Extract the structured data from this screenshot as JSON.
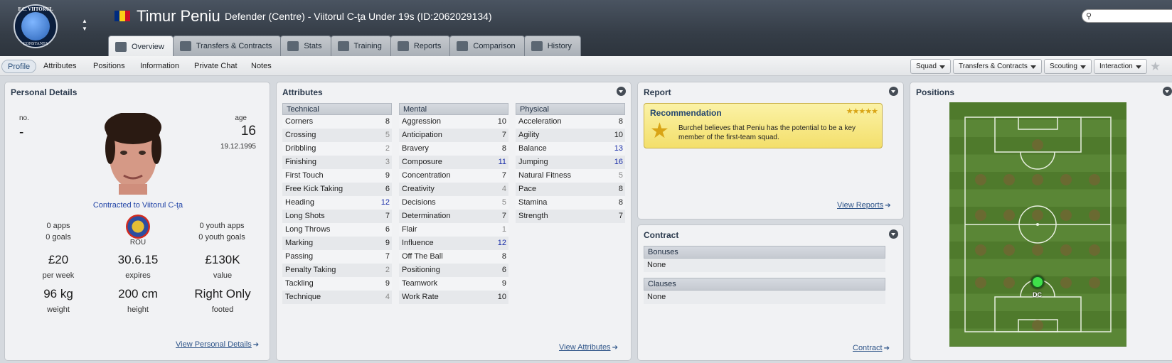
{
  "header": {
    "club_crest": {
      "top_text": "F.C. VIITORUL",
      "bottom_text": "CONSTANTA",
      "year": "2009"
    },
    "flag_colors": [
      "#002b7f",
      "#fcd116",
      "#ce1126"
    ],
    "player_name": "Timur Peniu",
    "player_subtitle": "Defender (Centre) - Viitorul C-ţa Under 19s (ID:2062029134)",
    "search_placeholder": ""
  },
  "tabs": [
    {
      "label": "Overview",
      "icon": "overview-icon",
      "active": true
    },
    {
      "label": "Transfers & Contracts",
      "icon": "document-icon"
    },
    {
      "label": "Stats",
      "icon": "stats-icon"
    },
    {
      "label": "Training",
      "icon": "training-icon"
    },
    {
      "label": "Reports",
      "icon": "report-icon"
    },
    {
      "label": "Comparison",
      "icon": "comparison-icon"
    },
    {
      "label": "History",
      "icon": "history-icon"
    }
  ],
  "subnav": {
    "links": [
      "Profile",
      "Attributes",
      "Positions",
      "Information",
      "Private Chat",
      "Notes"
    ],
    "active": "Profile",
    "dropdowns": [
      "Squad",
      "Transfers & Contracts",
      "Scouting",
      "Interaction"
    ]
  },
  "personal": {
    "title": "Personal Details",
    "no_label": "no.",
    "no_value": "-",
    "age_label": "age",
    "age_value": "16",
    "dob": "19.12.1995",
    "contracted": "Contracted to Viitorul C-ţa",
    "apps": "0 apps",
    "goals": "0 goals",
    "nation": "ROU",
    "youth_apps": "0 youth apps",
    "youth_goals": "0 youth goals",
    "wage": "£20",
    "wage_label": "per week",
    "expires": "30.6.15",
    "expires_label": "expires",
    "value": "£130K",
    "value_label": "value",
    "weight": "96 kg",
    "weight_label": "weight",
    "height": "200 cm",
    "height_label": "height",
    "footed": "Right Only",
    "footed_label": "footed",
    "link": "View Personal Details"
  },
  "attributes": {
    "title": "Attributes",
    "link": "View Attributes",
    "technical": {
      "header": "Technical",
      "rows": [
        {
          "name": "Corners",
          "value": 8
        },
        {
          "name": "Crossing",
          "value": 5
        },
        {
          "name": "Dribbling",
          "value": 2
        },
        {
          "name": "Finishing",
          "value": 3
        },
        {
          "name": "First Touch",
          "value": 9
        },
        {
          "name": "Free Kick Taking",
          "value": 6
        },
        {
          "name": "Heading",
          "value": 12
        },
        {
          "name": "Long Shots",
          "value": 7
        },
        {
          "name": "Long Throws",
          "value": 6
        },
        {
          "name": "Marking",
          "value": 9
        },
        {
          "name": "Passing",
          "value": 7
        },
        {
          "name": "Penalty Taking",
          "value": 2
        },
        {
          "name": "Tackling",
          "value": 9
        },
        {
          "name": "Technique",
          "value": 4
        }
      ]
    },
    "mental": {
      "header": "Mental",
      "rows": [
        {
          "name": "Aggression",
          "value": 10
        },
        {
          "name": "Anticipation",
          "value": 7
        },
        {
          "name": "Bravery",
          "value": 8
        },
        {
          "name": "Composure",
          "value": 11
        },
        {
          "name": "Concentration",
          "value": 7
        },
        {
          "name": "Creativity",
          "value": 4
        },
        {
          "name": "Decisions",
          "value": 5
        },
        {
          "name": "Determination",
          "value": 7
        },
        {
          "name": "Flair",
          "value": 1
        },
        {
          "name": "Influence",
          "value": 12
        },
        {
          "name": "Off The Ball",
          "value": 8
        },
        {
          "name": "Positioning",
          "value": 6
        },
        {
          "name": "Teamwork",
          "value": 9
        },
        {
          "name": "Work Rate",
          "value": 10
        }
      ]
    },
    "physical": {
      "header": "Physical",
      "rows": [
        {
          "name": "Acceleration",
          "value": 8
        },
        {
          "name": "Agility",
          "value": 10
        },
        {
          "name": "Balance",
          "value": 13
        },
        {
          "name": "Jumping",
          "value": 16
        },
        {
          "name": "Natural Fitness",
          "value": 5
        },
        {
          "name": "Pace",
          "value": 8
        },
        {
          "name": "Stamina",
          "value": 8
        },
        {
          "name": "Strength",
          "value": 7
        }
      ]
    }
  },
  "report": {
    "title": "Report",
    "rec_title": "Recommendation",
    "rec_stars": 5,
    "rec_text": "Burchel believes that Peniu has the potential to be a key member of the first-team squad.",
    "link": "View Reports"
  },
  "contract": {
    "title": "Contract",
    "bonuses_header": "Bonuses",
    "bonuses_value": "None",
    "clauses_header": "Clauses",
    "clauses_value": "None",
    "link": "Contract"
  },
  "positions": {
    "title": "Positions",
    "main_label": "DC"
  }
}
